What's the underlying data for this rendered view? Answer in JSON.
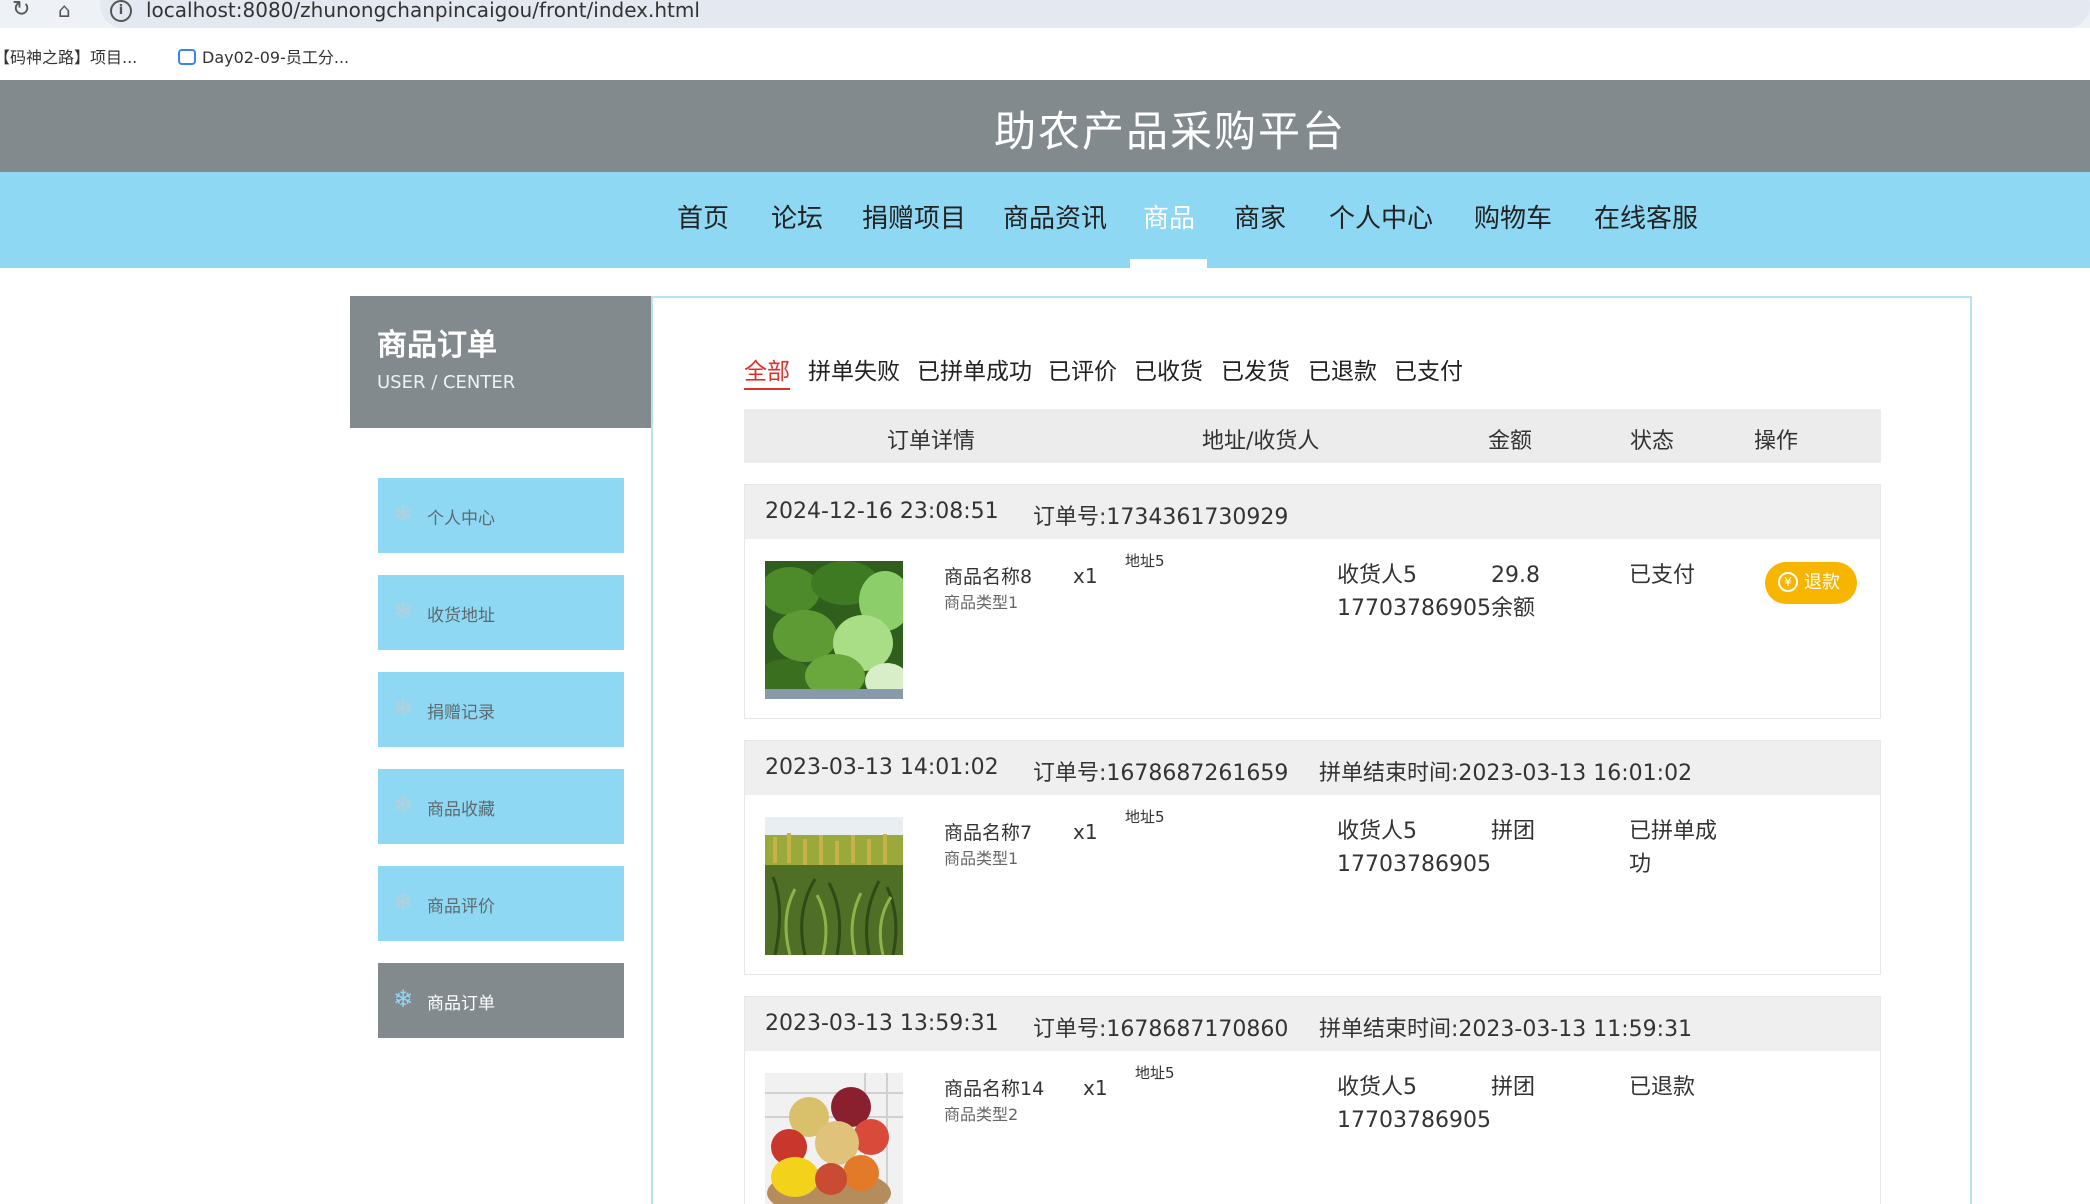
{
  "browser": {
    "url": "localhost:8080/zhunongchanpincaigou/front/index.html",
    "bookmarks": [
      "【码神之路】项目...",
      "Day02-09-员工分..."
    ]
  },
  "site": {
    "title": "助农产品采购平台",
    "nav": [
      "首页",
      "论坛",
      "捐赠项目",
      "商品资讯",
      "商品",
      "商家",
      "个人中心",
      "购物车",
      "在线客服"
    ],
    "active_nav": "商品"
  },
  "sidebar": {
    "title": "商品订单",
    "subtitle": "USER / CENTER",
    "items": [
      {
        "label": "个人中心"
      },
      {
        "label": "收货地址"
      },
      {
        "label": "捐赠记录"
      },
      {
        "label": "商品收藏"
      },
      {
        "label": "商品评价"
      },
      {
        "label": "商品订单"
      }
    ],
    "active_item": "商品订单"
  },
  "status_tabs": [
    "全部",
    "拼单失败",
    "已拼单成功",
    "已评价",
    "已收货",
    "已发货",
    "已退款",
    "已支付"
  ],
  "active_status_tab": "全部",
  "table_headers": [
    "订单详情",
    "地址/收货人",
    "金额",
    "状态",
    "操作"
  ],
  "orders": [
    {
      "time": "2024-12-16 23:08:51",
      "order_no": "订单号:1734361730929",
      "end_time": "",
      "product_name": "商品名称8",
      "product_type": "商品类型1",
      "qty": "x1",
      "address": "地址5",
      "receiver": "收货人5",
      "phone": "17703786905",
      "amount": "29.8",
      "pay_type": "余额",
      "status": "已支付",
      "action": "退款",
      "action_icon": "yen-icon"
    },
    {
      "time": "2023-03-13 14:01:02",
      "order_no": "订单号:1678687261659",
      "end_time": "拼单结束时间:2023-03-13 16:01:02",
      "product_name": "商品名称7",
      "product_type": "商品类型1",
      "qty": "x1",
      "address": "地址5",
      "receiver": "收货人5",
      "phone": "17703786905",
      "amount": "拼团",
      "pay_type": "",
      "status": "已拼单成功"
    },
    {
      "time": "2023-03-13 13:59:31",
      "order_no": "订单号:1678687170860",
      "end_time": "拼单结束时间:2023-03-13 11:59:31",
      "product_name": "商品名称14",
      "product_type": "商品类型2",
      "qty": "x1",
      "address": "地址5",
      "receiver": "收货人5",
      "phone": "17703786905",
      "amount": "拼团",
      "pay_type": "",
      "status": "已退款"
    }
  ],
  "colors": {
    "header_gray": "#838a8d",
    "nav_blue": "#8fd8f3",
    "active_red": "#e0302a",
    "refund_orange": "#f7b500"
  }
}
